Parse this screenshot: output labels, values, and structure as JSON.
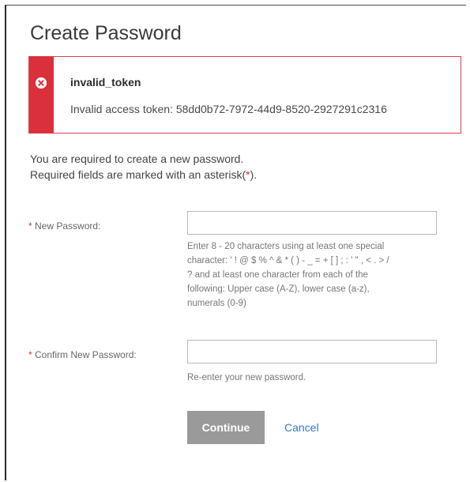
{
  "page": {
    "title": "Create Password"
  },
  "alert": {
    "icon": "error-x-icon",
    "color": "#d9303c",
    "title": "invalid_token",
    "message": "Invalid access token: 58dd0b72-7972-44d9-8520-2927291c2316"
  },
  "intro": {
    "line1": "You are required to create a new password.",
    "line2_prefix": "Required fields are marked with an asterisk(",
    "line2_asterisk": "*",
    "line2_suffix": ")."
  },
  "form": {
    "new_password": {
      "asterisk": "*",
      "label": "New Password:",
      "value": "",
      "hint_lines": [
        "Enter 8 - 20 characters using at least one special",
        "character: ' ! @ $ % ^ & * ( ) - _ = + [ ] ; : ' \" , < . > /",
        "? and at least one character from each of the",
        "following: Upper case (A-Z), lower case (a-z),",
        "numerals (0-9)"
      ]
    },
    "confirm_password": {
      "asterisk": "*",
      "label": "Confirm New Password:",
      "value": "",
      "hint": "Re-enter your new password."
    }
  },
  "actions": {
    "continue_label": "Continue",
    "cancel_label": "Cancel",
    "link_color": "#3b76c4"
  }
}
